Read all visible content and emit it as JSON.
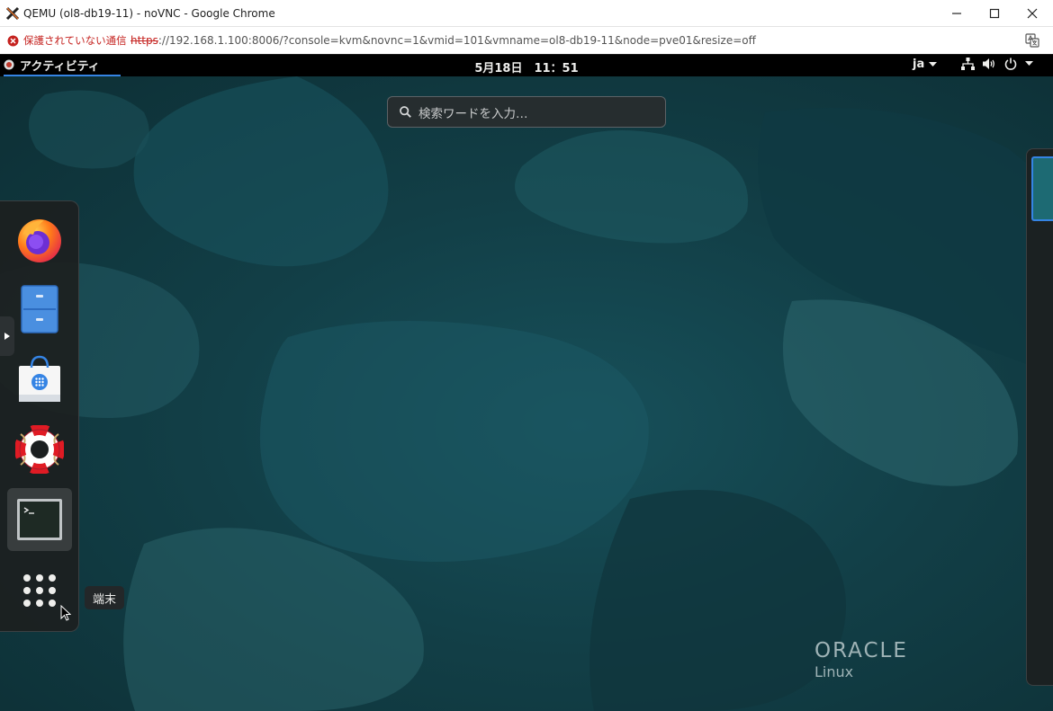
{
  "window": {
    "title": "QEMU (ol8-db19-11) - noVNC - Google Chrome"
  },
  "addressbar": {
    "security_label": "保護されていない通信",
    "url_scheme": "https",
    "url_rest": "://192.168.1.100:8006/?console=kvm&novnc=1&vmid=101&vmname=ol8-db19-11&node=pve01&resize=off"
  },
  "topbar": {
    "activities": "アクティビティ",
    "clock": "5月18日　11：51",
    "input_source": "ja"
  },
  "search": {
    "placeholder": "検索ワードを入力…"
  },
  "dash": {
    "items": [
      "firefox-icon",
      "files-icon",
      "software-icon",
      "help-icon",
      "terminal-icon",
      "show-apps-icon"
    ],
    "tooltip": "端末"
  },
  "branding": {
    "line1": "ORACLE",
    "line2": "Linux"
  },
  "colors": {
    "accent": "#3584e4",
    "insecure": "#c5221f",
    "desktop": "#123f47"
  }
}
